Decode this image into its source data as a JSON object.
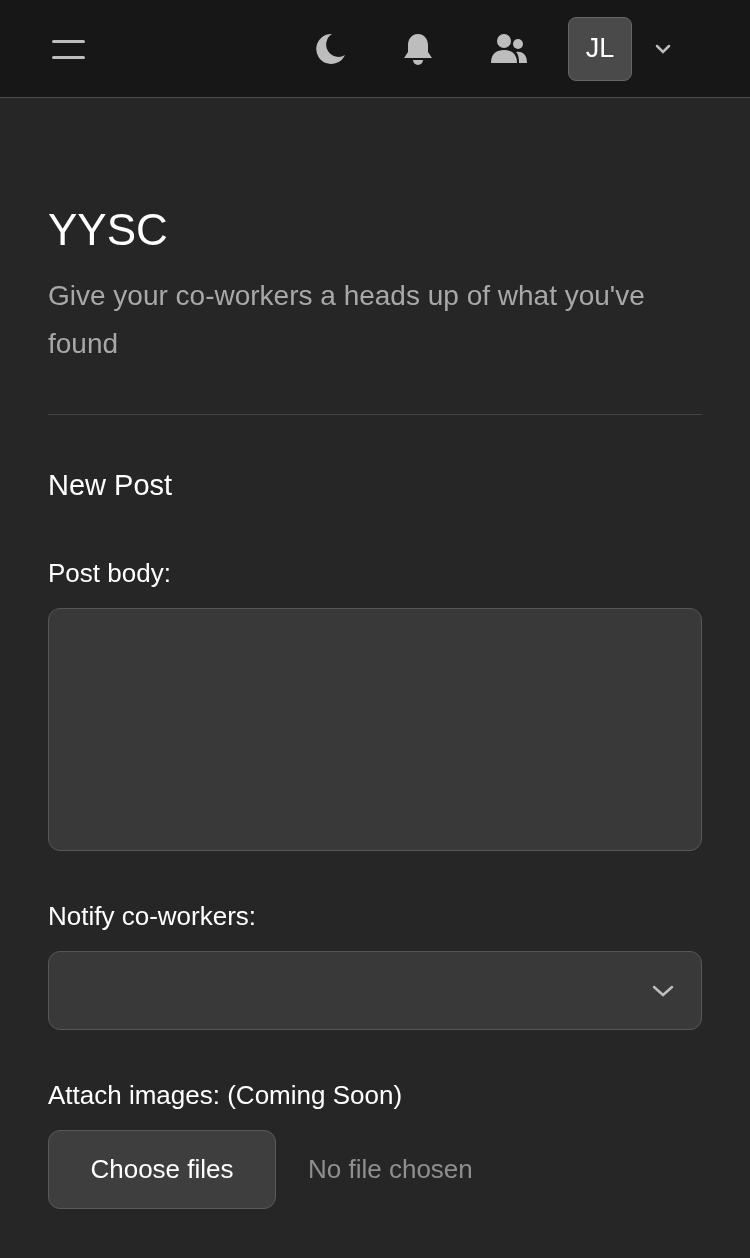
{
  "header": {
    "avatar_initials": "JL"
  },
  "page": {
    "title": "YYSC",
    "subtitle": "Give your co-workers a heads up of what you've found"
  },
  "form": {
    "title": "New Post",
    "fields": [
      {
        "kind": "textarea",
        "label": "Post body:"
      },
      {
        "kind": "select",
        "label": "Notify co-workers:"
      },
      {
        "kind": "file",
        "label": "Attach images: (Coming Soon)",
        "button": "Choose files",
        "status": "No file chosen"
      }
    ]
  }
}
